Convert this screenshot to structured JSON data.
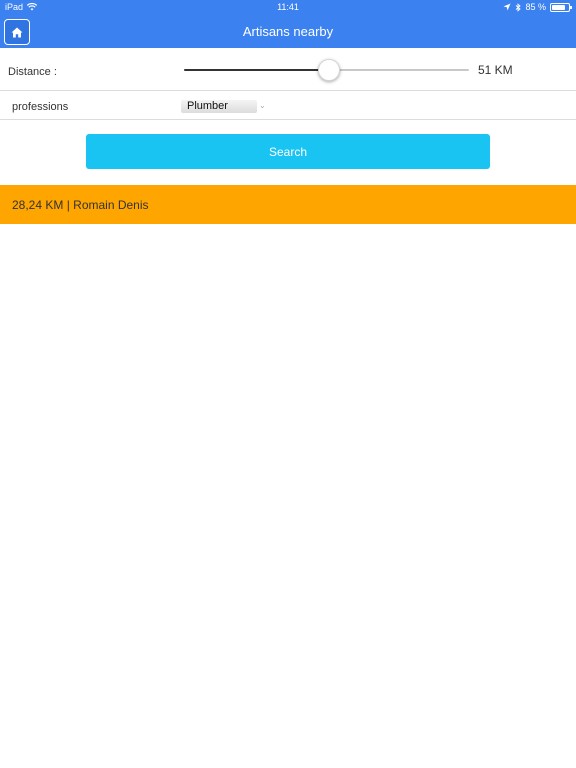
{
  "status_bar": {
    "device": "iPad",
    "time": "11:41",
    "battery_percent": "85 %",
    "battery_level": 0.85,
    "icons": [
      "wifi-icon",
      "location-arrow-icon",
      "bluetooth-icon",
      "battery-icon"
    ]
  },
  "nav": {
    "title": "Artisans nearby",
    "home_icon": "home-icon"
  },
  "distance": {
    "label": "Distance :",
    "value_text": "51 KM",
    "slider_fraction": 0.51
  },
  "professions": {
    "label": "professions",
    "selected": "Plumber"
  },
  "search": {
    "label": "Search"
  },
  "results": [
    {
      "text": "28,24 KM | Romain Denis"
    }
  ],
  "colors": {
    "nav_bg": "#3b82f0",
    "search_button": "#19c3f2",
    "result_row": "#ffa500"
  }
}
